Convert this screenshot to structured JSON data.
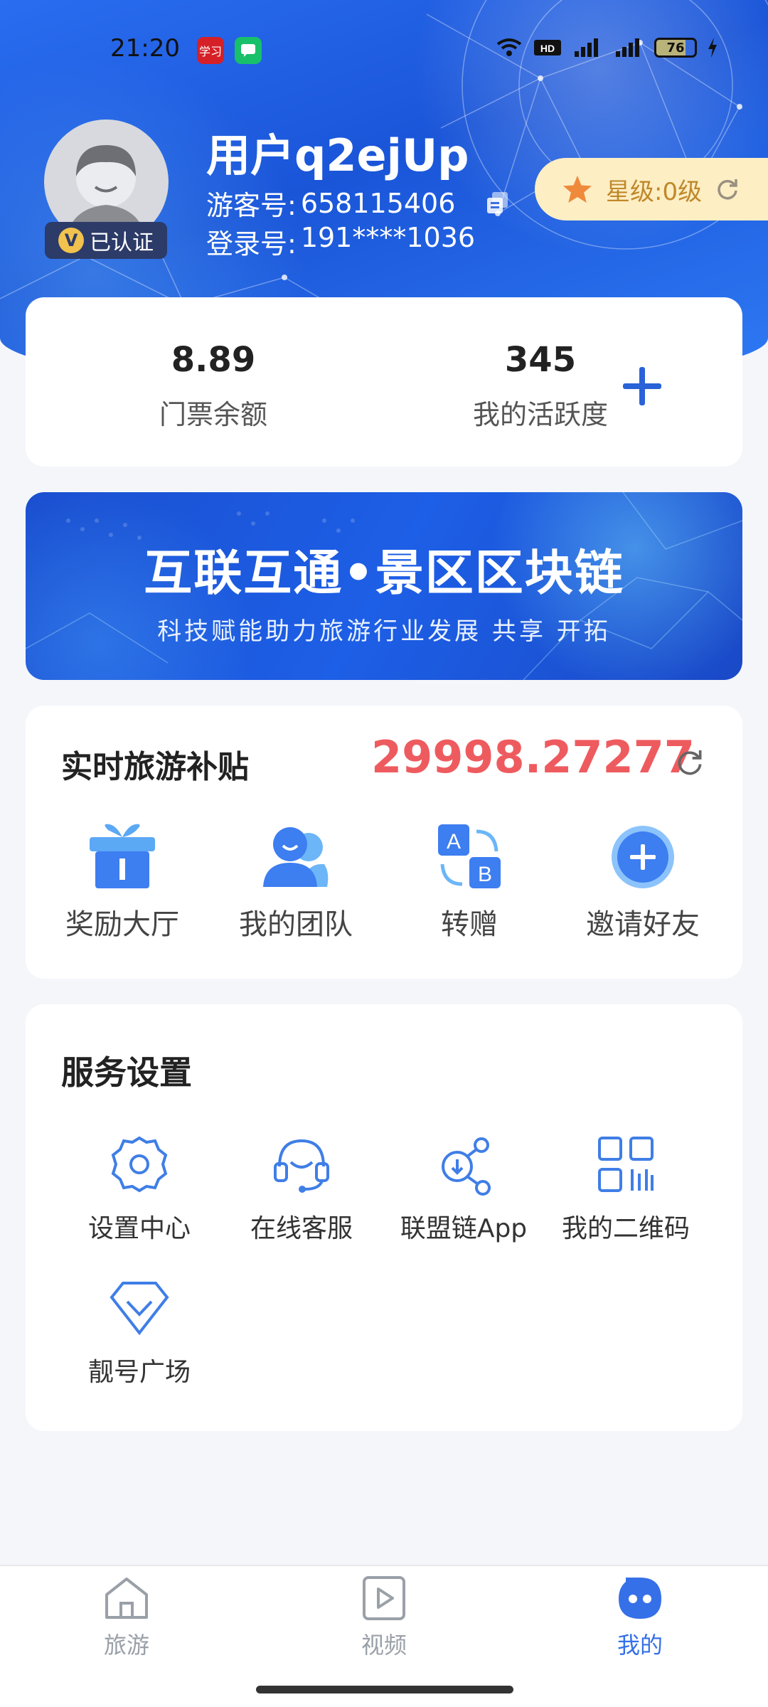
{
  "status_bar": {
    "time": "21:20",
    "app_badge_1": "学习",
    "battery": "76"
  },
  "profile": {
    "username": "用户q2ejUp",
    "guest_label": "游客号:",
    "guest_id": "658115406",
    "login_label": "登录号:",
    "login_id": "191****1036",
    "verified_label": "已认证",
    "star_level": "星级:0级"
  },
  "stats": {
    "ticket_balance_value": "8.89",
    "ticket_balance_label": "门票余额",
    "activity_value": "345",
    "activity_label": "我的活跃度"
  },
  "banner": {
    "title": "互联互通•景区区块链",
    "subtitle": "科技赋能助力旅游行业发展 共享 开拓"
  },
  "subsidy": {
    "title": "实时旅游补贴",
    "value": "29998.27277",
    "actions": [
      {
        "label": "奖励大厅",
        "icon": "gift-icon"
      },
      {
        "label": "我的团队",
        "icon": "team-icon"
      },
      {
        "label": "转赠",
        "icon": "transfer-icon"
      },
      {
        "label": "邀请好友",
        "icon": "invite-plus-icon"
      }
    ]
  },
  "services": {
    "title": "服务设置",
    "items": [
      {
        "label": "设置中心",
        "icon": "gear-icon"
      },
      {
        "label": "在线客服",
        "icon": "headset-icon"
      },
      {
        "label": "联盟链App",
        "icon": "share-nodes-icon"
      },
      {
        "label": "我的二维码",
        "icon": "qr-code-icon"
      },
      {
        "label": "靓号广场",
        "icon": "diamond-icon"
      }
    ]
  },
  "bottom_nav": [
    {
      "label": "旅游",
      "icon": "home-icon",
      "active": false
    },
    {
      "label": "视频",
      "icon": "video-icon",
      "active": false
    },
    {
      "label": "我的",
      "icon": "profile-face-icon",
      "active": true
    }
  ],
  "colors": {
    "accent": "#3570e8",
    "subsidy_red": "#ee5b5f",
    "star_gold": "#c0882a"
  }
}
